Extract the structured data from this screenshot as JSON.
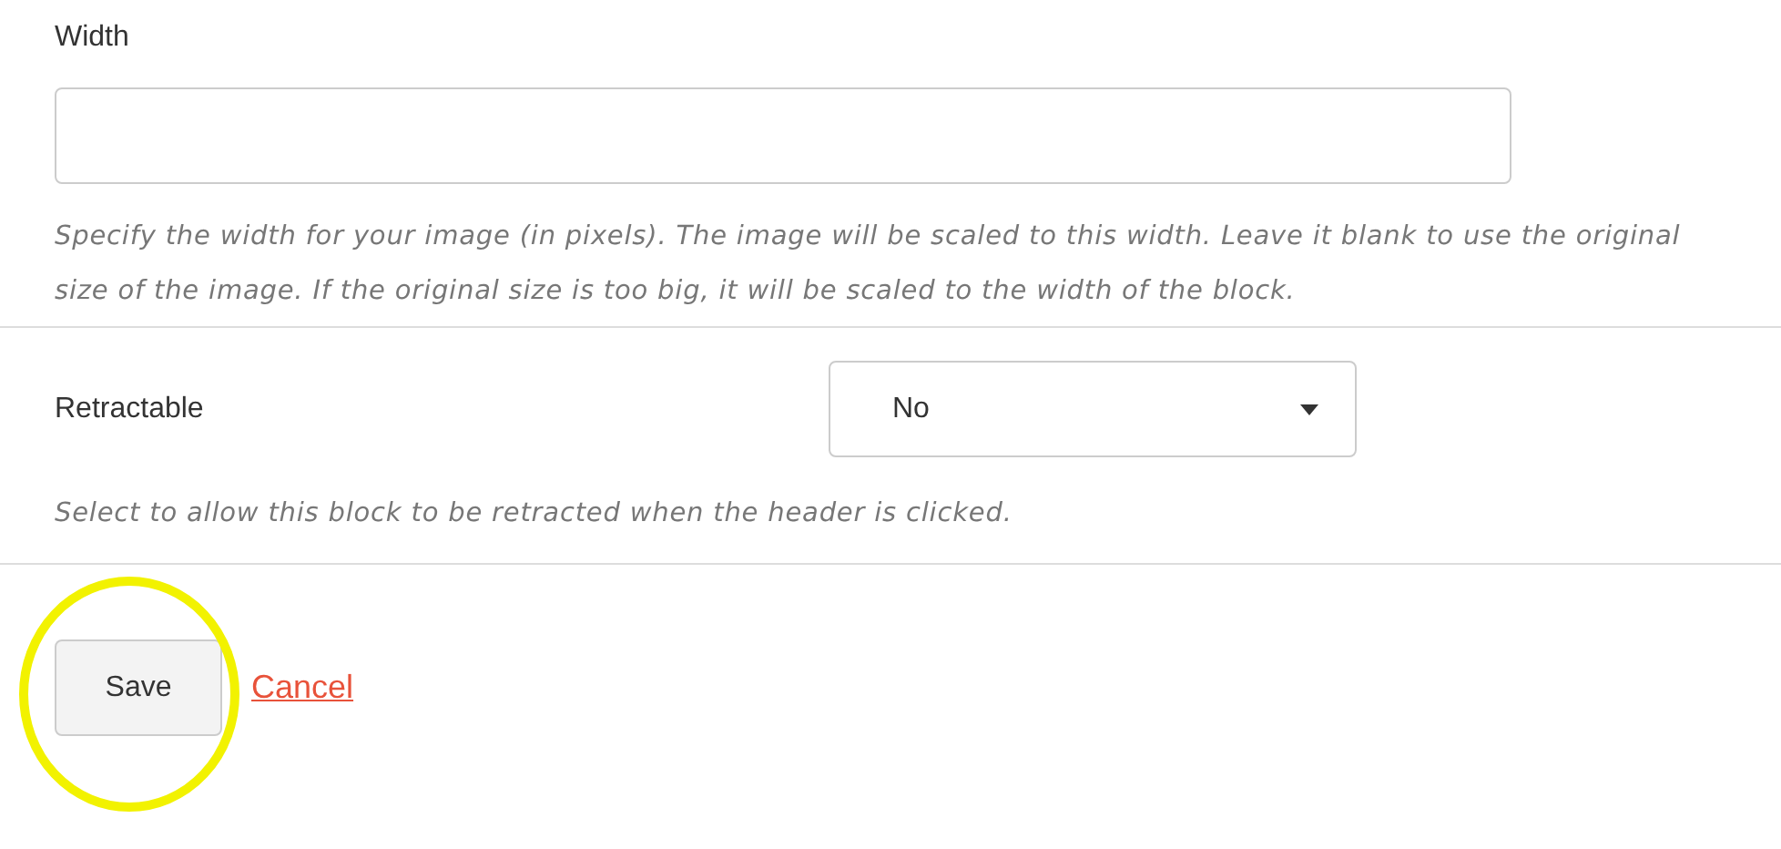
{
  "width_field": {
    "label": "Width",
    "help": "Specify the width for your image (in pixels). The image will be scaled to this width. Leave it blank to use the original size of the image. If the original size is too big, it will be scaled to the width of the block."
  },
  "retractable": {
    "label": "Retractable",
    "value": "No",
    "help": "Select to allow this block to be retracted when the header is clicked."
  },
  "save_button": {
    "label": "Save",
    "highlighted": true
  },
  "cancel_link": "Cancel"
}
